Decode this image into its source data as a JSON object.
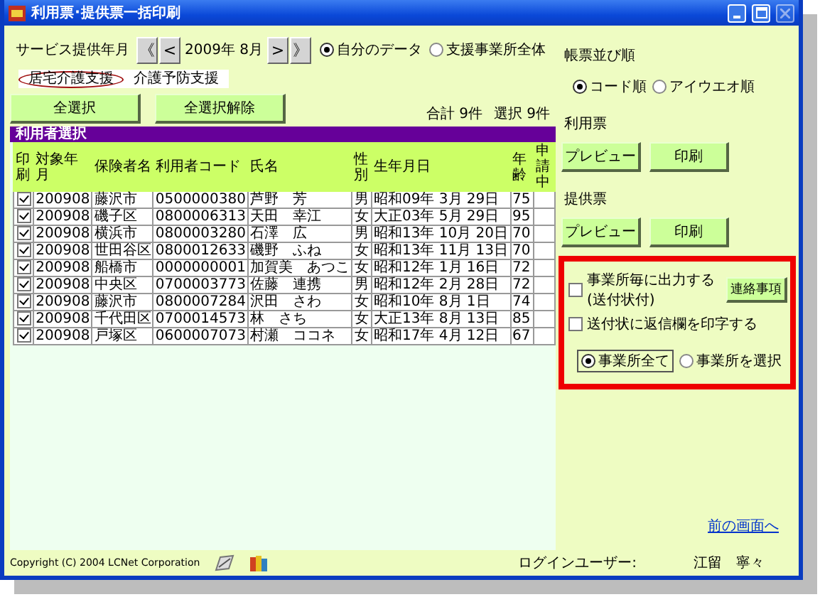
{
  "window": {
    "title": "利用票･提供票一括印刷"
  },
  "period": {
    "label": "サービス提供年月",
    "prev_buttons": [
      "《",
      "<"
    ],
    "value": "2009年 8月",
    "next_buttons": [
      ">",
      "》"
    ]
  },
  "scope_options": [
    {
      "label": "自分のデータ",
      "selected": true
    },
    {
      "label": "支援事業所全体",
      "selected": false
    }
  ],
  "tabs": [
    {
      "label": "居宅介護支援",
      "selected": true
    },
    {
      "label": "介護予防支援",
      "selected": false
    }
  ],
  "select_buttons": [
    "全選択",
    "全選択解除"
  ],
  "totals": [
    "合計 9件",
    "選択 9件"
  ],
  "table": {
    "title": "利用者選択",
    "columns": [
      "印刷",
      "対象年月",
      "保険者名",
      "利用者コード",
      "氏名",
      "性別",
      "生年月日",
      "年齢",
      "申請中"
    ],
    "rows": [
      {
        "print": true,
        "cells": [
          "",
          "200908",
          "藤沢市",
          "0500000380",
          "芦野　芳",
          "男",
          "昭和09年 3月 29日",
          "75",
          ""
        ]
      },
      {
        "print": true,
        "cells": [
          "",
          "200908",
          "磯子区",
          "0800006313",
          "天田　幸江",
          "女",
          "大正03年 5月 29日",
          "95",
          ""
        ]
      },
      {
        "print": true,
        "cells": [
          "",
          "200908",
          "横浜市",
          "0800003280",
          "石澤　広",
          "男",
          "昭和13年 10月 20日",
          "70",
          ""
        ]
      },
      {
        "print": true,
        "cells": [
          "",
          "200908",
          "世田谷区",
          "0800012633",
          "磯野　ふね",
          "女",
          "昭和13年 11月 13日",
          "70",
          ""
        ]
      },
      {
        "print": true,
        "cells": [
          "",
          "200908",
          "船橋市",
          "0000000001",
          "加賀美　あつこ",
          "女",
          "昭和12年 1月 16日",
          "72",
          ""
        ]
      },
      {
        "print": true,
        "cells": [
          "",
          "200908",
          "中央区",
          "0700003773",
          "佐藤　連携",
          "男",
          "昭和12年 2月 28日",
          "72",
          ""
        ]
      },
      {
        "print": true,
        "cells": [
          "",
          "200908",
          "藤沢市",
          "0800007284",
          "沢田　さわ",
          "女",
          "昭和10年 8月 1日",
          "74",
          ""
        ]
      },
      {
        "print": true,
        "cells": [
          "",
          "200908",
          "千代田区",
          "0700014573",
          "林　さち",
          "女",
          "大正13年 8月 13日",
          "85",
          ""
        ]
      },
      {
        "print": true,
        "cells": [
          "",
          "200908",
          "戸塚区",
          "0600007073",
          "村瀬　ココネ",
          "女",
          "昭和17年 4月 12日",
          "67",
          ""
        ]
      }
    ]
  },
  "sort": {
    "label": "帳票並び順",
    "options": [
      {
        "label": "コード順",
        "selected": true
      },
      {
        "label": "アイウエオ順",
        "selected": false
      }
    ]
  },
  "forms": [
    {
      "label": "利用票",
      "buttons": [
        "プレビュー",
        "印刷"
      ]
    },
    {
      "label": "提供票",
      "buttons": [
        "プレビュー",
        "印刷"
      ]
    }
  ],
  "output_options": {
    "checkboxes": [
      {
        "label": "事業所毎に出力する(送付状付)",
        "checked": false
      },
      {
        "label": "送付状に返信欄を印字する",
        "checked": false
      }
    ],
    "note_button": "連絡事項",
    "radios": [
      {
        "label": "事業所全て",
        "selected": true
      },
      {
        "label": "事業所を選択",
        "selected": false
      }
    ]
  },
  "back_link": "前の画面へ",
  "status_bar": {
    "copyright": "Copyright (C) 2004 LCNet Corporation",
    "login_label": "ログインユーザー:",
    "user": "江留　寧々"
  }
}
